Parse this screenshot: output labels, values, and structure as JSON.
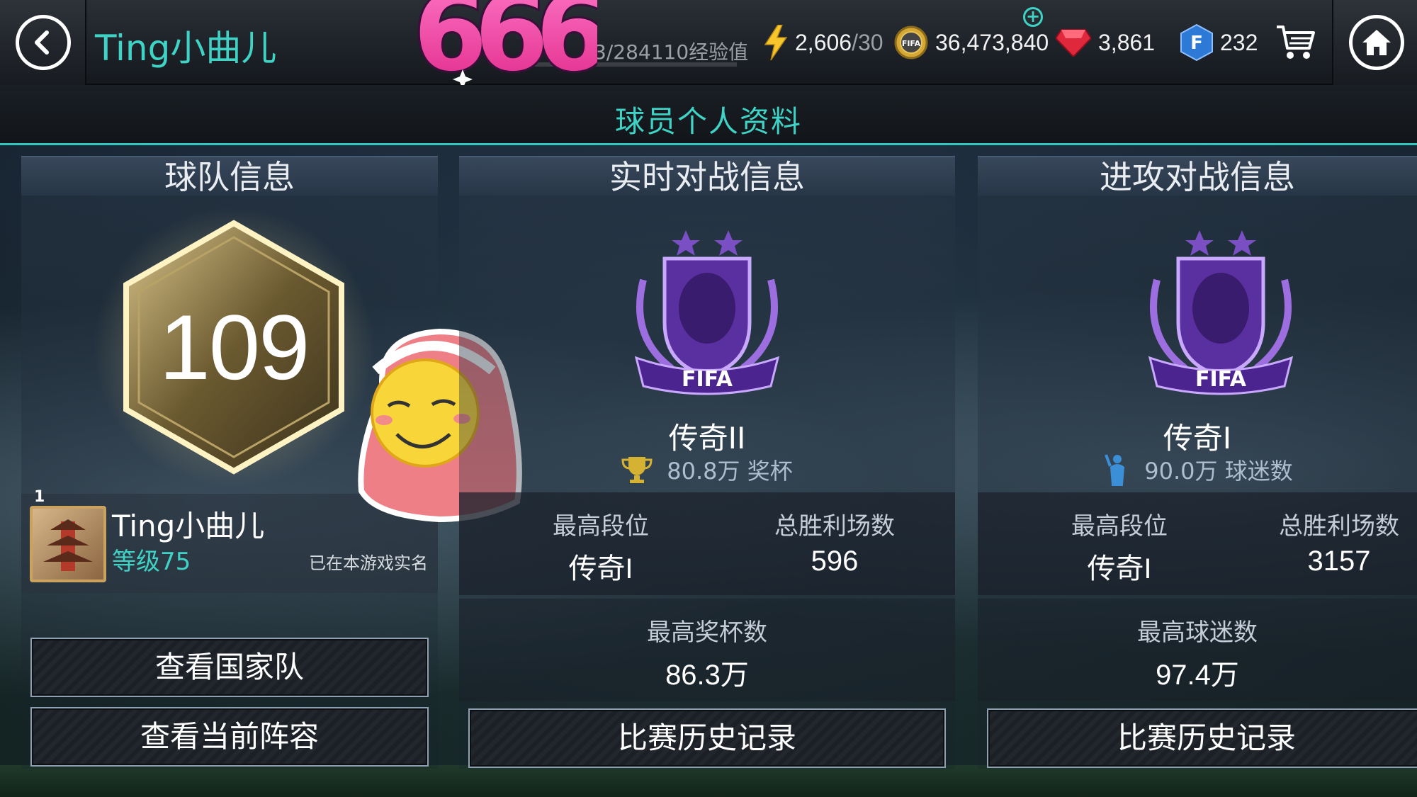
{
  "topbar": {
    "player_name": "Ting小曲儿",
    "level_badge_text": "666",
    "xp_text": "3/284110经验值",
    "energy": {
      "value": "2,606",
      "max": "/30"
    },
    "coins": "36,473,840",
    "gems": "3,861",
    "fifa_points": "232"
  },
  "page_title": "球员个人资料",
  "team": {
    "header": "球队信息",
    "level": "109",
    "avatar_rank": "1",
    "name": "Ting小曲儿",
    "player_level": "等级75",
    "verified_text": "已在本游戏实名",
    "btn_national": "查看国家队",
    "btn_lineup": "查看当前阵容"
  },
  "live": {
    "header": "实时对战信息",
    "rank": "传奇II",
    "sub_value": "80.8万 奖杯",
    "best_rank_label": "最高段位",
    "best_rank": "传奇I",
    "wins_label": "总胜利场数",
    "wins": "596",
    "best_metric_label": "最高奖杯数",
    "best_metric": "86.3万",
    "history_btn": "比赛历史记录"
  },
  "attack": {
    "header": "进攻对战信息",
    "rank": "传奇I",
    "sub_value": "90.0万 球迷数",
    "best_rank_label": "最高段位",
    "best_rank": "传奇I",
    "wins_label": "总胜利场数",
    "wins": "3157",
    "best_metric_label": "最高球迷数",
    "best_metric": "97.4万",
    "history_btn": "比赛历史记录"
  },
  "icons": [
    "back-arrow-icon",
    "lightning-icon",
    "coin-icon",
    "gem-icon",
    "fifa-points-icon",
    "cart-icon",
    "home-icon",
    "trophy-icon",
    "fan-icon",
    "fifa-emblem-icon",
    "sticker-emoji"
  ],
  "colors": {
    "accent": "#3fd3c6",
    "panel_text": "#c4cdd8",
    "gold": "#c9a25f"
  }
}
